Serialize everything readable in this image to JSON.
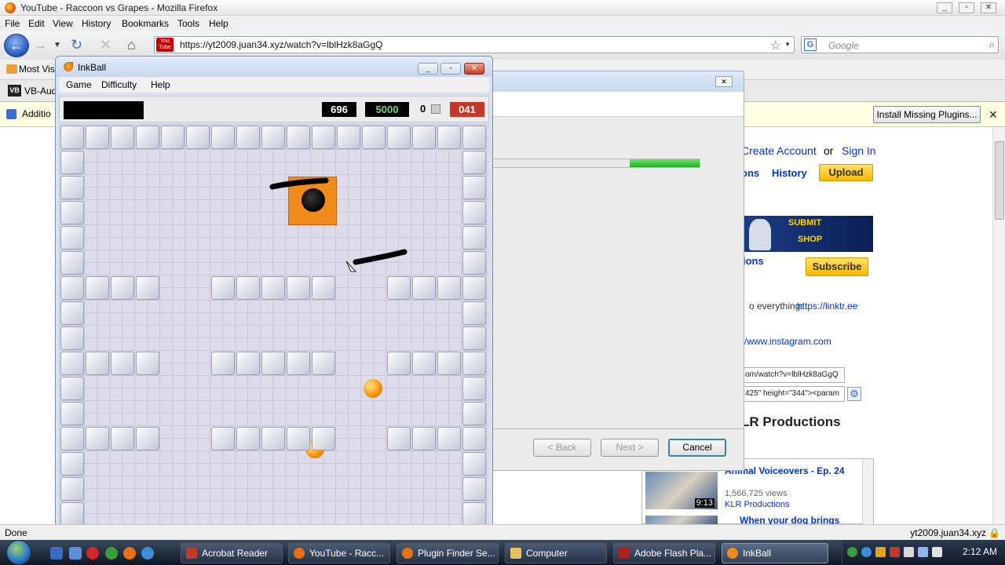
{
  "firefox": {
    "title": "YouTube - Raccoon vs Grapes - Mozilla Firefox",
    "menu": [
      "File",
      "Edit",
      "View",
      "History",
      "Bookmarks",
      "Tools",
      "Help"
    ],
    "url": "https://yt2009.juan34.xyz/watch?v=lblHzk8aGgQ",
    "search_placeholder": "Google",
    "bookmark_most_visited": "Most Vis",
    "tab_label": "VB-Aud",
    "notification_text": "Additio",
    "install_plugins_button": "Install Missing Plugins...",
    "status_left": "Done",
    "status_right": "yt2009.juan34.xyz"
  },
  "youtube": {
    "create_account": "Create Account",
    "or": "or",
    "sign_in": "Sign In",
    "nav_partial": "ons",
    "history": "History",
    "upload": "Upload",
    "banner_line1": "SUBMIT",
    "banner_line2": "SHOP",
    "section_partial": "ions",
    "subscribe": "Subscribe",
    "desc_partial": "o everything: ",
    "desc_link": "https://linktr.ee",
    "instagram_link": "/www.instagram.com",
    "url_field": "om/watch?v=lblHzk8aGgQ",
    "embed_field": "425\" height=\"344\"><param",
    "channel_title": "LR Productions",
    "related": [
      {
        "title": "Animal Voiceovers - Ep. 24",
        "views": "1,566,725 views",
        "channel": "KLR Productions",
        "duration": "9:13"
      },
      {
        "title": "When your dog brings",
        "views": "",
        "channel": "",
        "duration": ""
      }
    ]
  },
  "wizard": {
    "back": "< Back",
    "next": "Next >",
    "cancel": "Cancel",
    "progress": 0.34
  },
  "inkball": {
    "title": "InkBall",
    "menu": [
      "Game",
      "Difficulty",
      "Help"
    ],
    "time": "696",
    "score": "5000",
    "counter": "0",
    "remaining": "041"
  },
  "taskbar": {
    "items": [
      "Acrobat Reader",
      "YouTube - Racc...",
      "Plugin Finder Se...",
      "Computer",
      "Adobe Flash Pla...",
      "InkBall"
    ],
    "active": "InkBall",
    "clock": "2:12 AM"
  },
  "colors": {
    "accent_green": "#1fae1f",
    "youtube_link": "#0033cc",
    "score_red": "#c0392b",
    "score_green": "#7dd37d"
  }
}
